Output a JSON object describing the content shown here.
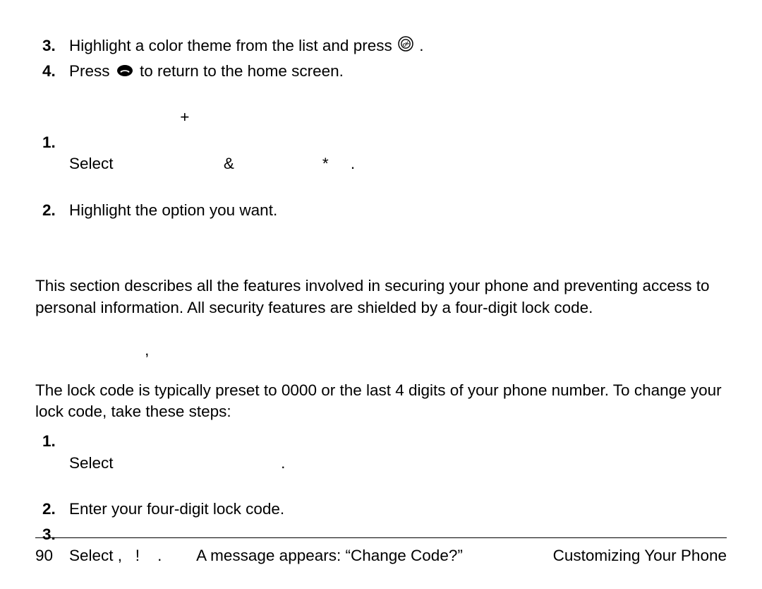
{
  "list1": {
    "item3": {
      "num": "3.",
      "text_a": "Highlight a color theme from the list and press ",
      "text_b": " ."
    },
    "item4": {
      "num": "4.",
      "text_a": "Press ",
      "text_b": " to return to the home screen."
    }
  },
  "heading2": "+",
  "list2": {
    "item1": {
      "num": "1.",
      "text_a": "Select",
      "gap1": "                         ",
      "amp": "&",
      "gap2": "                    ",
      "star": "*",
      "gap3": "     ",
      "dot": "."
    },
    "item2": {
      "num": "2.",
      "text": "Highlight the option you want."
    }
  },
  "para1": "This section describes all the features involved in securing your phone and preventing access to personal information. All security features are shielded by a four-digit lock code.",
  "heading3": ",",
  "para2": "The lock code is typically preset to 0000 or the last 4 digits of your phone number. To change your lock code, take these steps:",
  "list3": {
    "item1": {
      "num": "1.",
      "text_a": "Select",
      "gap1": "                                      ",
      "dot": "."
    },
    "item2": {
      "num": "2.",
      "text": "Enter your four-digit lock code."
    },
    "item3": {
      "num": "3.",
      "text_a": "Select ,   ! ",
      "gap1": "   ",
      "dot": ".",
      "gap2": "        ",
      "text_b": "A message appears: “Change Code?”"
    }
  },
  "footer": {
    "page": "90",
    "title": "Customizing Your Phone"
  }
}
